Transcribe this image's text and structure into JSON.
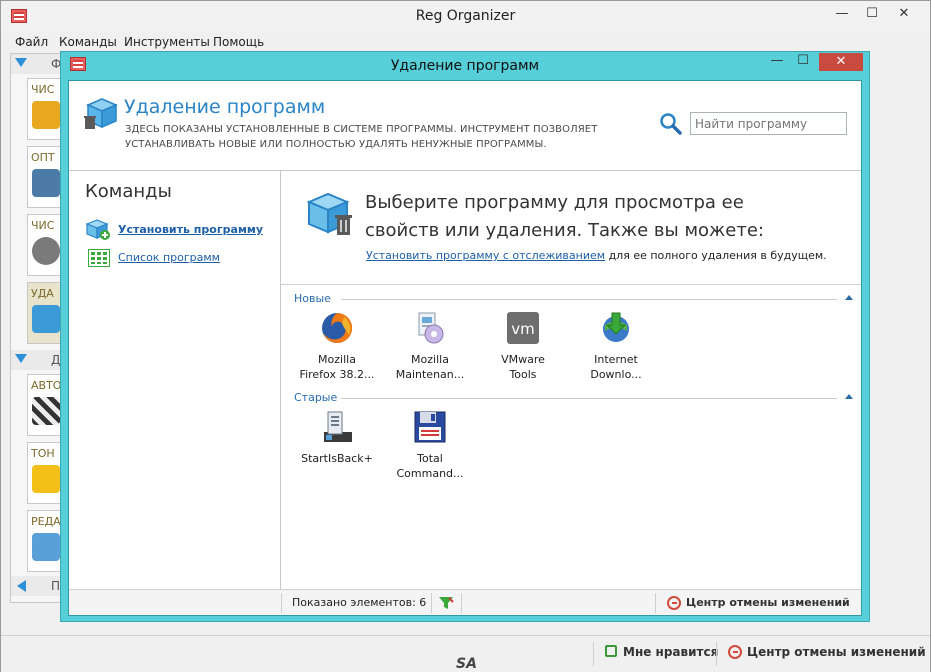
{
  "main_window": {
    "title": "Reg Organizer",
    "controls": {
      "minimize": "—",
      "maximize": "☐",
      "close": "✕"
    },
    "menu": [
      "Файл",
      "Команды",
      "Инструменты",
      "Помощь"
    ]
  },
  "sidebar": {
    "group1_label": "Ф",
    "cards1": [
      "ЧИС",
      "ОПТ",
      "ЧИС",
      "УДА"
    ],
    "group2_label": "Д",
    "cards2": [
      "АВТО",
      "ТОН",
      "РЕДА"
    ],
    "group3_label": "П"
  },
  "main_status": {
    "like_label": "Мне нравится",
    "undo_center_label": "Центр отмены изменений",
    "watermark": "SA"
  },
  "dialog": {
    "title": "Удаление программ",
    "controls": {
      "minimize": "—",
      "maximize": "☐",
      "close": "✕"
    },
    "header": {
      "title": "Удаление программ",
      "description_line1": "ЗДЕСЬ ПОКАЗАНЫ УСТАНОВЛЕННЫЕ В СИСТЕМЕ ПРОГРАММЫ. ИНСТРУМЕНТ ПОЗВОЛЯЕТ",
      "description_line2": "УСТАНАВЛИВАТЬ НОВЫЕ ИЛИ ПОЛНОСТЬЮ УДАЛЯТЬ НЕНУЖНЫЕ ПРОГРАММЫ.",
      "search_placeholder": "Найти программу"
    },
    "commands": {
      "title": "Команды",
      "items": [
        {
          "label": "Установить программу",
          "icon": "install-box-icon"
        },
        {
          "label": "Список программ",
          "icon": "program-list-icon"
        }
      ]
    },
    "info": {
      "line1": "Выберите программу для просмотра ее",
      "line2": "свойств или удаления. Также вы можете:",
      "link": "Установить программу с отслеживанием",
      "link_suffix": " для ее полного удаления в будущем."
    },
    "groups": [
      {
        "label": "Новые",
        "programs": [
          {
            "name_line1": "Mozilla",
            "name_line2": "Firefox 38.2...",
            "icon": "firefox-icon"
          },
          {
            "name_line1": "Mozilla",
            "name_line2": "Maintenan...",
            "icon": "mozilla-maintenance-icon"
          },
          {
            "name_line1": "VMware",
            "name_line2": "Tools",
            "icon": "vmware-icon"
          },
          {
            "name_line1": "Internet",
            "name_line2": "Downlo...",
            "icon": "internet-download-manager-icon"
          }
        ]
      },
      {
        "label": "Старые",
        "programs": [
          {
            "name_line1": "StartIsBack+",
            "name_line2": "",
            "icon": "startisback-icon"
          },
          {
            "name_line1": "Total",
            "name_line2": "Command...",
            "icon": "total-commander-icon"
          }
        ]
      }
    ],
    "status": {
      "shown_count": "Показано элементов: 6",
      "undo_center_label": "Центр отмены изменений"
    }
  }
}
